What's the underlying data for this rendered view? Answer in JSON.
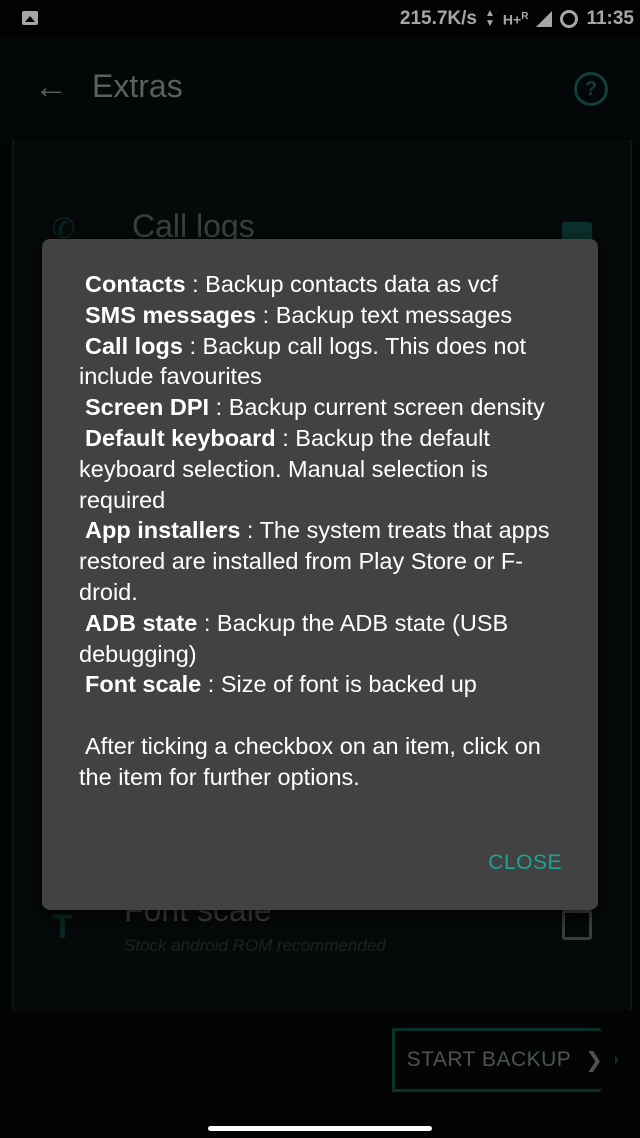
{
  "status_bar": {
    "speed": "215.7K/s",
    "network": "H+",
    "roaming": "R",
    "time": "11:35",
    "icons": [
      "image-icon",
      "data-arrows-icon",
      "signal-icon",
      "sync-icon"
    ]
  },
  "app_bar": {
    "title": "Extras",
    "icons": [
      "back-arrow-icon",
      "help-icon"
    ],
    "help_glyph": "?"
  },
  "background_list": {
    "call_logs_title": "Call logs",
    "font_scale_title": "Font scale",
    "font_scale_subtitle": "Stock android ROM recommended",
    "call_logs_checked": true,
    "font_scale_checked": false
  },
  "dialog": {
    "items": [
      {
        "term": "Contacts",
        "desc": "Backup contacts data as vcf"
      },
      {
        "term": "SMS messages",
        "desc": "Backup text messages"
      },
      {
        "term": "Call logs",
        "desc": "Backup call logs. This does not include favourites"
      },
      {
        "term": "Screen DPI",
        "desc": "Backup current screen density"
      },
      {
        "term": "Default keyboard",
        "desc": "Backup the default keyboard selection. Manual selection is required"
      },
      {
        "term": "App installers",
        "desc": "The system treats that apps restored are installed from Play Store or F-droid."
      },
      {
        "term": "ADB state",
        "desc": "Backup the ADB state (USB debugging)"
      },
      {
        "term": "Font scale",
        "desc": "Size of font is backed up"
      }
    ],
    "separator": " : ",
    "note": "After ticking a checkbox on an item, click on the item for further options.",
    "close_label": "CLOSE"
  },
  "bottom": {
    "start_backup_label": "START BACKUP",
    "chevron": "❯"
  },
  "colors": {
    "accent": "#1aa596",
    "dialog_bg": "#424242",
    "background": "#050808"
  }
}
